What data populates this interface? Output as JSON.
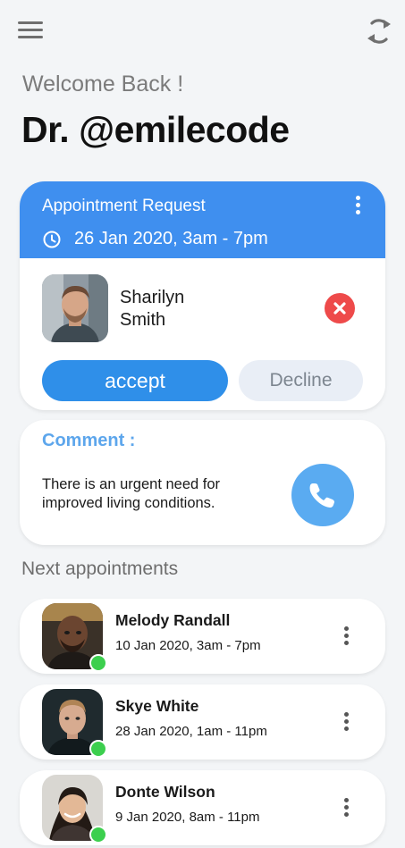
{
  "header": {
    "greeting": "Welcome Back !",
    "doctor_name": "Dr. @emilecode"
  },
  "appointment_request": {
    "title": "Appointment Request",
    "datetime": "26 Jan 2020, 3am - 7pm",
    "patient_name": "Sharilyn Smith",
    "accept_label": "accept",
    "decline_label": "Decline",
    "header_color": "#3f8fef",
    "accept_color": "#2f8fe9",
    "reject_color": "#ee4a4a"
  },
  "comment": {
    "title": "Comment :",
    "text": "There is an urgent need for improved living conditions.",
    "call_button_color": "#5aabf1"
  },
  "next_appointments": {
    "title": "Next appointments",
    "items": [
      {
        "name": "Melody Randall",
        "datetime": "10 Jan 2020, 3am - 7pm",
        "status": "online"
      },
      {
        "name": "Skye White",
        "datetime": "28 Jan 2020, 1am - 11pm",
        "status": "online"
      },
      {
        "name": "Donte Wilson",
        "datetime": "9 Jan 2020, 8am - 11pm",
        "status": "online"
      }
    ]
  },
  "icons": {
    "menu": "hamburger-menu-icon",
    "refresh": "sync-icon",
    "more": "more-vertical-icon",
    "clock": "clock-icon",
    "close": "close-circle-icon",
    "phone": "phone-icon",
    "online": "online-status-dot"
  }
}
